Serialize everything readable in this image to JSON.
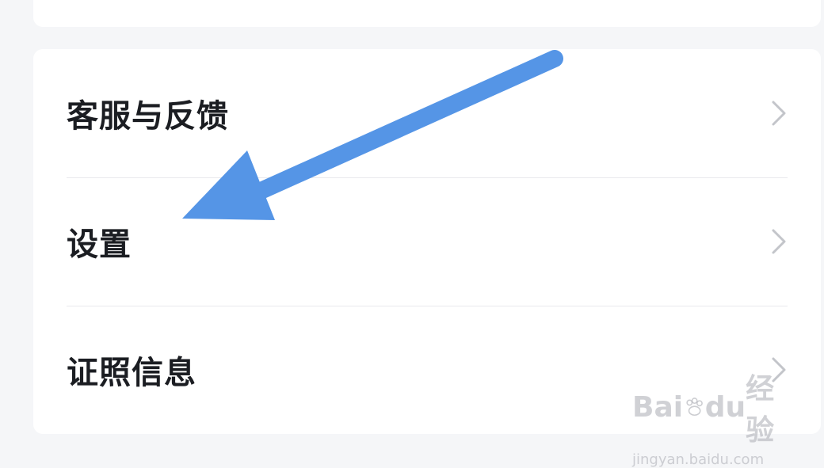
{
  "menu": {
    "items": [
      {
        "label": "客服与反馈"
      },
      {
        "label": "设置"
      },
      {
        "label": "证照信息"
      }
    ]
  },
  "annotation": {
    "arrow_color": "#5595e6"
  },
  "watermark": {
    "brand_left": "Bai",
    "brand_mid": "du",
    "brand_right": "经验",
    "url": "jingyan.baidu.com"
  },
  "colors": {
    "background": "#f5f6f8",
    "card": "#ffffff",
    "text": "#1b1d22",
    "divider": "#e8e9ec",
    "chevron": "#c3c5ca"
  },
  "icons": {
    "row_chevron": "chevron-right-icon",
    "watermark_paw": "paw-icon"
  }
}
